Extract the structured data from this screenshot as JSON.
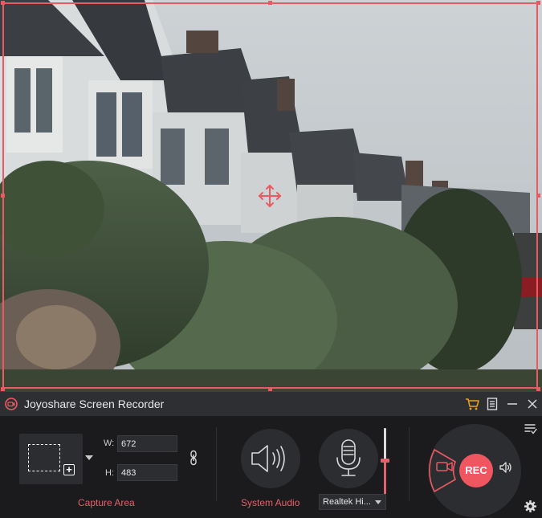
{
  "app": {
    "title": "Joyoshare Screen Recorder",
    "accent_color": "#ea5a63"
  },
  "titlebar_icons": [
    "cart-icon",
    "menu-icon",
    "minimize-icon",
    "close-icon"
  ],
  "capture_area": {
    "width_label": "W:",
    "width_value": "672",
    "height_label": "H:",
    "height_value": "483",
    "section_label": "Capture Area"
  },
  "audio": {
    "system_audio_label": "System Audio",
    "mic_device": "Realtek Hi...",
    "mic_volume_fraction": 0.55
  },
  "record": {
    "rec_label": "REC"
  }
}
